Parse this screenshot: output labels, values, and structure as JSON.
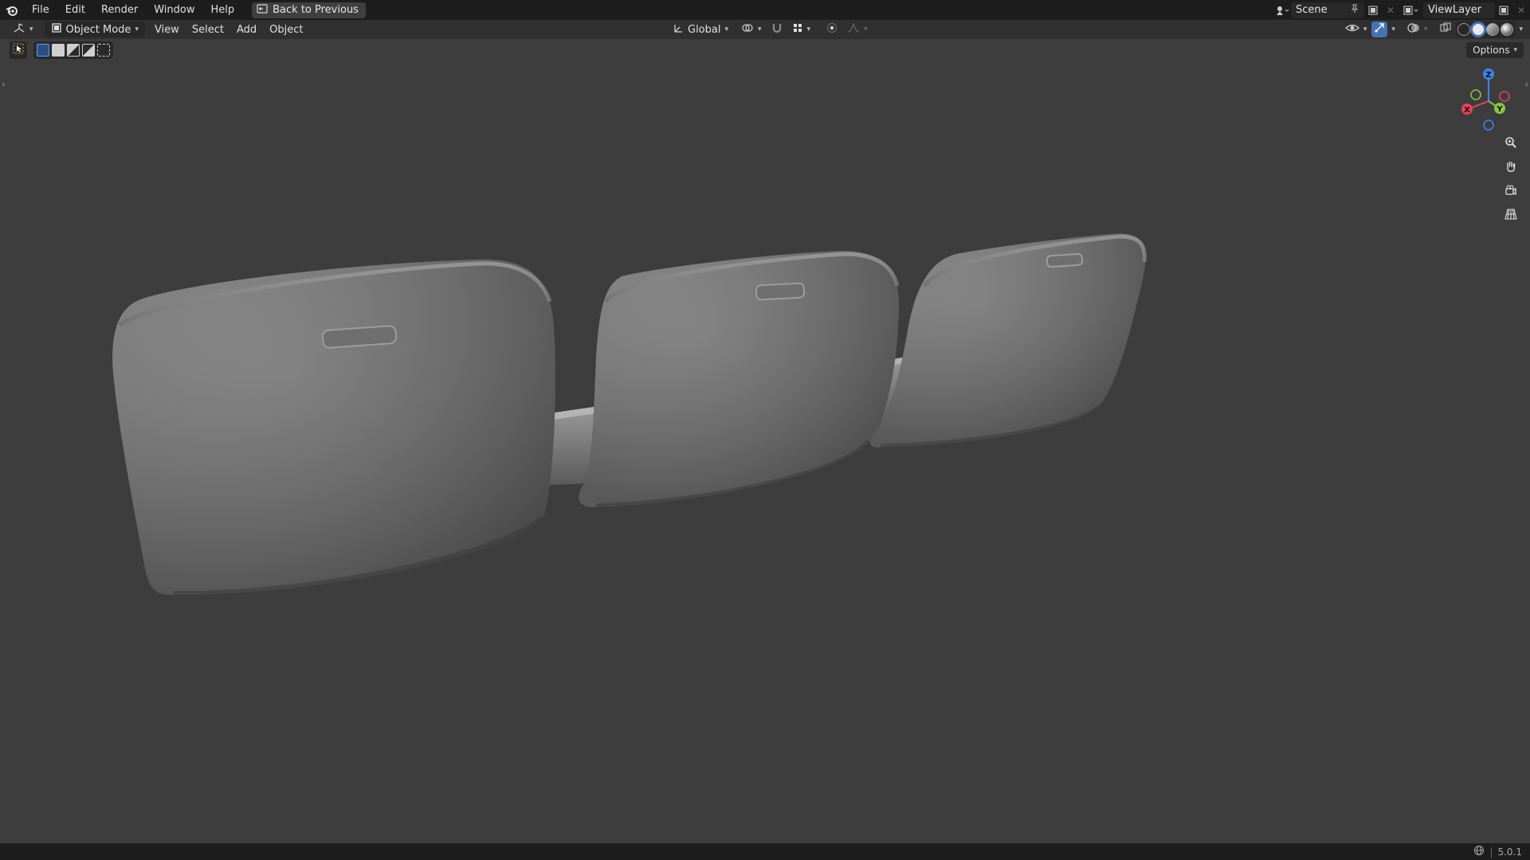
{
  "topbar": {
    "menu": [
      "File",
      "Edit",
      "Render",
      "Window",
      "Help"
    ],
    "back_button": "Back to Previous",
    "scene_name": "Scene",
    "view_layer": "ViewLayer"
  },
  "header": {
    "mode": "Object Mode",
    "menus": [
      "View",
      "Select",
      "Add",
      "Object"
    ],
    "orientation": "Global"
  },
  "viewport": {
    "options_label": "Options",
    "gizmo": {
      "x": "X",
      "y": "Y",
      "z": "Z"
    }
  },
  "status": {
    "version": "5.0.1"
  },
  "colors": {
    "accent_blue": "#4772b3",
    "axis_x": "#e8425a",
    "axis_y": "#8bc443",
    "axis_z": "#3c84e8",
    "background": "#3d3d3d"
  }
}
